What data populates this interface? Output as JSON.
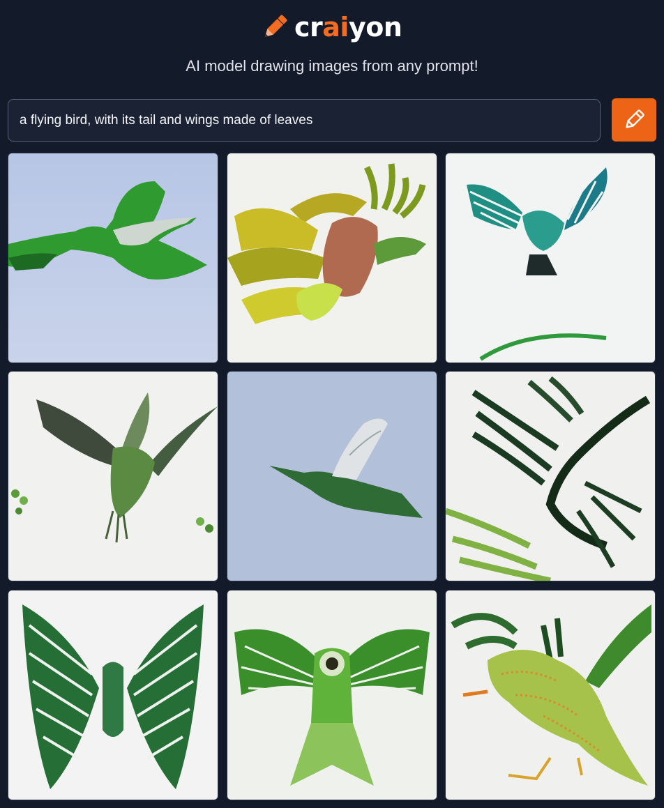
{
  "header": {
    "logo_prefix": "cr",
    "logo_ai": "ai",
    "logo_suffix": "yon",
    "tagline": "AI model drawing images from any prompt!"
  },
  "prompt": {
    "value": "a flying bird, with its tail and wings made of leaves",
    "button_icon": "pencil-icon"
  },
  "colors": {
    "background": "#131a29",
    "accent": "#ed6417",
    "input_border": "#59627a"
  },
  "results": {
    "grid": "3x3",
    "images": [
      {
        "name": "result-image-1"
      },
      {
        "name": "result-image-2"
      },
      {
        "name": "result-image-3"
      },
      {
        "name": "result-image-4"
      },
      {
        "name": "result-image-5"
      },
      {
        "name": "result-image-6"
      },
      {
        "name": "result-image-7"
      },
      {
        "name": "result-image-8"
      },
      {
        "name": "result-image-9"
      }
    ]
  }
}
